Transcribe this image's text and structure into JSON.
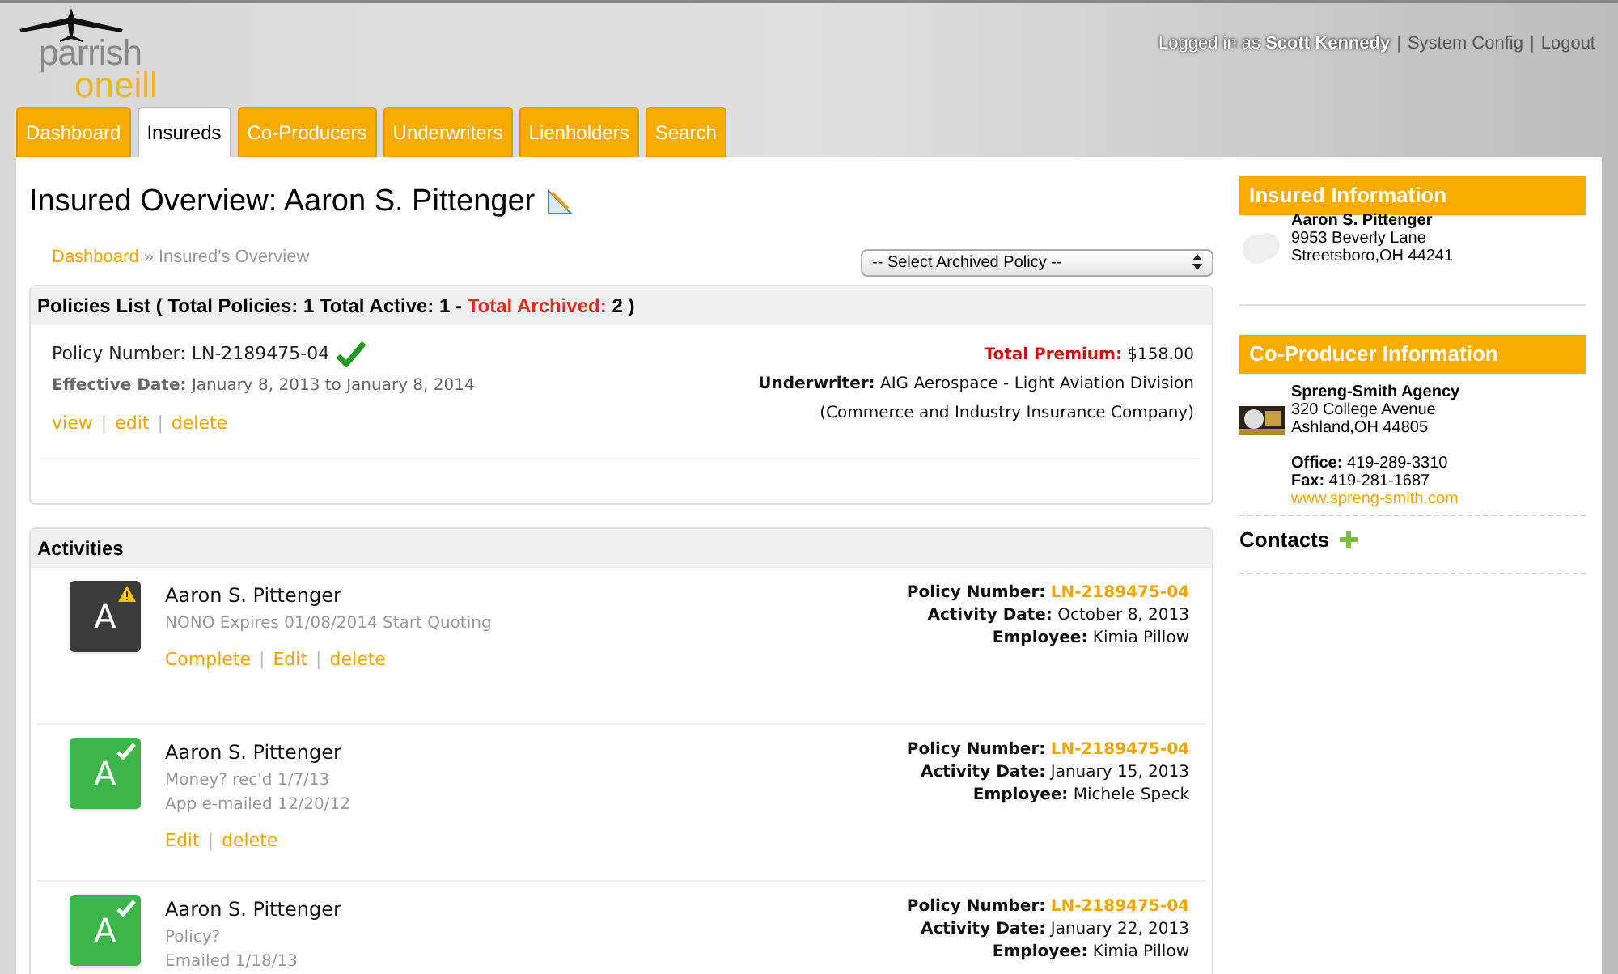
{
  "logo": {
    "line1": "parrish",
    "line2": "oneill"
  },
  "user_bar": {
    "prefix": "Logged in as",
    "user": "Scott Kennedy",
    "separator": "|",
    "links": [
      "System Config",
      "Logout"
    ]
  },
  "link_separator": "|",
  "tabs": [
    {
      "label": "Dashboard",
      "selected": false
    },
    {
      "label": "Insureds",
      "selected": true
    },
    {
      "label": "Co-Producers",
      "selected": false
    },
    {
      "label": "Underwriters",
      "selected": false
    },
    {
      "label": "Lienholders",
      "selected": false
    },
    {
      "label": "Search",
      "selected": false
    }
  ],
  "page_title": "Insured Overview: Aaron S. Pittenger",
  "breadcrumb": {
    "link": "Dashboard",
    "separator": "»",
    "current": "Insured's Overview"
  },
  "archived_select": {
    "value": "-- Select Archived Policy --"
  },
  "policies": {
    "title": "Policies List ( Total Policies: 1 Total Active: 1 - ",
    "archived_label": "Total Archived:",
    "archived_value": "2 )",
    "items": [
      {
        "number_label": "Policy Number:",
        "number": "LN-2189475-04",
        "active": true,
        "dates_label": "Effective Date:",
        "dates": "January 8, 2013 to January 8, 2014",
        "links": [
          "view",
          "edit",
          "delete"
        ],
        "premium_label": "Total Premium:",
        "premium": "$158.00",
        "underwriter_label": "Underwriter:",
        "underwriter": "AIG Aerospace - Light Aviation Division",
        "underwriter_company": "(Commerce and Industry Insurance Company)"
      }
    ]
  },
  "activities": {
    "title": "Activities",
    "items": [
      {
        "kind": "pending",
        "letter": "A",
        "name": "Aaron S. Pittenger",
        "notes": [
          "NONO Expires 01/08/2014 Start Quoting"
        ],
        "links": [
          "Complete",
          "Edit",
          "delete"
        ],
        "policy_label": "Policy Number:",
        "policy": "LN-2189475-04",
        "date_label": "Activity Date:",
        "date": "October 8, 2013",
        "employee_label": "Employee:",
        "employee": "Kimia Pillow"
      },
      {
        "kind": "done",
        "letter": "A",
        "name": "Aaron S. Pittenger",
        "notes": [
          "Money? rec'd 1/7/13",
          "App e-mailed 12/20/12"
        ],
        "links": [
          "Edit",
          "delete"
        ],
        "policy_label": "Policy Number:",
        "policy": "LN-2189475-04",
        "date_label": "Activity Date:",
        "date": "January 15, 2013",
        "employee_label": "Employee:",
        "employee": "Michele Speck"
      },
      {
        "kind": "done",
        "letter": "A",
        "name": "Aaron S. Pittenger",
        "notes": [
          "Policy?",
          "Emailed 1/18/13"
        ],
        "policy_label": "Policy Number:",
        "policy": "LN-2189475-04",
        "date_label": "Activity Date:",
        "date": "January 22, 2013",
        "employee_label": "Employee:",
        "employee": "Kimia Pillow"
      }
    ]
  },
  "insured_info": {
    "title": "Insured Information",
    "name": "Aaron S. Pittenger",
    "address": "9953 Beverly Lane",
    "city": "Streetsboro,OH 44241"
  },
  "coproducer_info": {
    "title": "Co-Producer Information",
    "name": "Spreng-Smith Agency",
    "address": "320 College Avenue",
    "city": "Ashland,OH 44805",
    "office_label": "Office:",
    "office": "419-289-3310",
    "fax_label": "Fax:",
    "fax": "419-281-1687",
    "website": "www.spreng-smith.com"
  },
  "contacts": {
    "title": "Contacts"
  }
}
